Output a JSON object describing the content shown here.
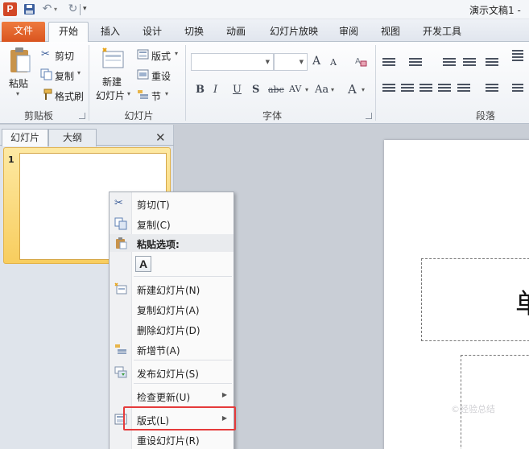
{
  "title_bar": {
    "app_logo": "P",
    "doc_title": "演示文稿1 -"
  },
  "tabs": [
    {
      "label": "文件"
    },
    {
      "label": "开始"
    },
    {
      "label": "插入"
    },
    {
      "label": "设计"
    },
    {
      "label": "切换"
    },
    {
      "label": "动画"
    },
    {
      "label": "幻灯片放映"
    },
    {
      "label": "审阅"
    },
    {
      "label": "视图"
    },
    {
      "label": "开发工具"
    }
  ],
  "ribbon": {
    "clipboard": {
      "paste": "粘贴",
      "cut": "剪切",
      "copy": "复制",
      "format_painter": "格式刷",
      "group_label": "剪贴板"
    },
    "slides": {
      "new_slide_line1": "新建",
      "new_slide_line2": "幻灯片",
      "layout": "版式",
      "reset": "重设",
      "section": "节",
      "group_label": "幻灯片"
    },
    "font": {
      "grow": "A",
      "shrink": "A",
      "bold": "B",
      "italic": "I",
      "underline": "U",
      "shadow": "S",
      "strike": "abc",
      "spacing": "AV",
      "case": "Aa",
      "color": "A",
      "group_label": "字体"
    },
    "paragraph": {
      "group_label": "段落"
    }
  },
  "left_panel": {
    "tab_slides": "幻灯片",
    "tab_outline": "大纲",
    "close": "✕",
    "slide_number": "1"
  },
  "slide": {
    "title_glyph": "单"
  },
  "context_menu": {
    "items": [
      {
        "label": "剪切(T)",
        "icon": "scissors-icon"
      },
      {
        "label": "复制(C)",
        "icon": "copy-icon"
      },
      {
        "label": "粘贴选项:",
        "icon": "paste-icon"
      },
      {
        "label": "新建幻灯片(N)",
        "icon": "new-slide-icon"
      },
      {
        "label": "复制幻灯片(A)"
      },
      {
        "label": "删除幻灯片(D)"
      },
      {
        "label": "新增节(A)",
        "icon": "add-section-icon"
      },
      {
        "label": "发布幻灯片(S)",
        "icon": "publish-slides-icon"
      },
      {
        "label": "检查更新(U)"
      },
      {
        "label": "版式(L)",
        "icon": "layout-icon"
      },
      {
        "label": "重设幻灯片(R)"
      }
    ],
    "paste_option": "A",
    "highlight_color": "#e53b3b"
  },
  "watermark": "©经验总结"
}
